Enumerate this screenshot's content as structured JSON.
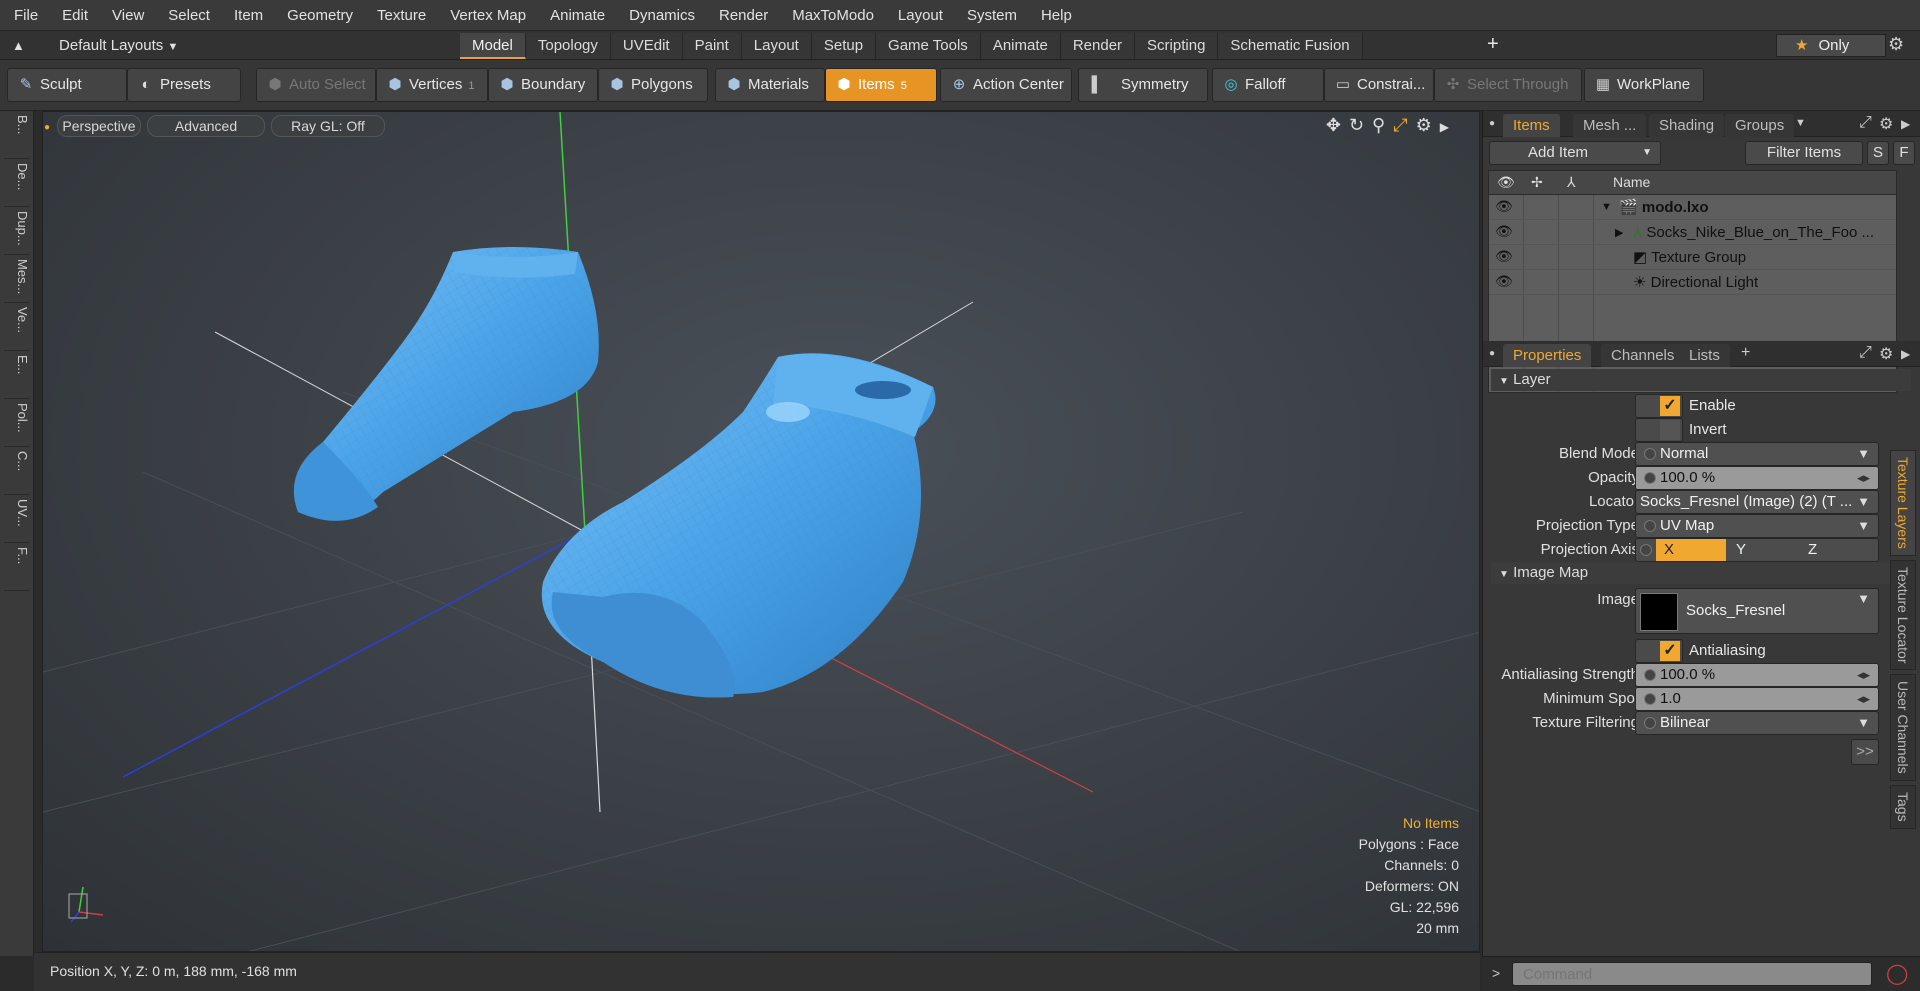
{
  "menu": [
    "File",
    "Edit",
    "View",
    "Select",
    "Item",
    "Geometry",
    "Texture",
    "Vertex Map",
    "Animate",
    "Dynamics",
    "Render",
    "MaxToModo",
    "Layout",
    "System",
    "Help"
  ],
  "layouts_label": "Default Layouts",
  "mode_tabs": [
    "Model",
    "Topology",
    "UVEdit",
    "Paint",
    "Layout",
    "Setup",
    "Game Tools",
    "Animate",
    "Render",
    "Scripting",
    "Schematic Fusion"
  ],
  "only_label": "Only",
  "toolbar": {
    "sculpt": "Sculpt",
    "presets": "Presets",
    "auto_select": "Auto Select",
    "vertices": "Vertices",
    "vertices_count": "1",
    "boundary": "Boundary",
    "polygons": "Polygons",
    "materials": "Materials",
    "items": "Items",
    "items_count": "5",
    "action_center": "Action Center",
    "symmetry": "Symmetry",
    "falloff": "Falloff",
    "constraints": "Constrai...",
    "select_through": "Select Through",
    "workplane": "WorkPlane"
  },
  "left_tabs": [
    "B...",
    "De...",
    "Dup...",
    "Mes...",
    "Ve...",
    "E...",
    "Pol...",
    "C...",
    "UV...",
    "F..."
  ],
  "viewport": {
    "view": "Perspective",
    "advanced": "Advanced",
    "raygl": "Ray GL: Off",
    "info": {
      "items": "No Items",
      "polygons": "Polygons : Face",
      "channels": "Channels: 0",
      "deformers": "Deformers: ON",
      "gl": "GL: 22,596",
      "scale": "20 mm"
    }
  },
  "status": "Position X, Y, Z:   0 m, 188 mm, -168 mm",
  "items_panel": {
    "tabs": [
      "Items",
      "Mesh ...",
      "Shading",
      "Groups"
    ],
    "add_item": "Add Item",
    "filter_items": "Filter Items",
    "s": "S",
    "f": "F",
    "name_header": "Name",
    "rows": [
      "modo.lxo",
      "Socks_Nike_Blue_on_The_Foo ...",
      "Texture Group",
      "Directional Light"
    ]
  },
  "properties": {
    "tabs": [
      "Properties",
      "Channels",
      "Lists"
    ],
    "layer_section": "Layer",
    "enable": "Enable",
    "invert": "Invert",
    "blend_mode_label": "Blend Mode",
    "blend_mode": "Normal",
    "opacity_label": "Opacity",
    "opacity": "100.0 %",
    "locator_label": "Locator",
    "locator": "Socks_Fresnel (Image) (2) (T ...",
    "projection_type_label": "Projection Type",
    "projection_type": "UV Map",
    "projection_axis_label": "Projection Axis",
    "axis_x": "X",
    "axis_y": "Y",
    "axis_z": "Z",
    "image_map_section": "Image Map",
    "image_label": "Image",
    "image": "Socks_Fresnel",
    "antialiasing": "Antialiasing",
    "aa_strength_label": "Antialiasing Strength",
    "aa_strength": "100.0 %",
    "min_spot_label": "Minimum Spot",
    "min_spot": "1.0",
    "filtering_label": "Texture Filtering",
    "filtering": "Bilinear",
    "more": ">>"
  },
  "side_tabs": [
    "Texture Layers",
    "Texture Locator",
    "User Channels",
    "Tags"
  ],
  "command_placeholder": "Command",
  "colors": {
    "accent": "#f0a830",
    "sock": "#4aa3e8"
  }
}
